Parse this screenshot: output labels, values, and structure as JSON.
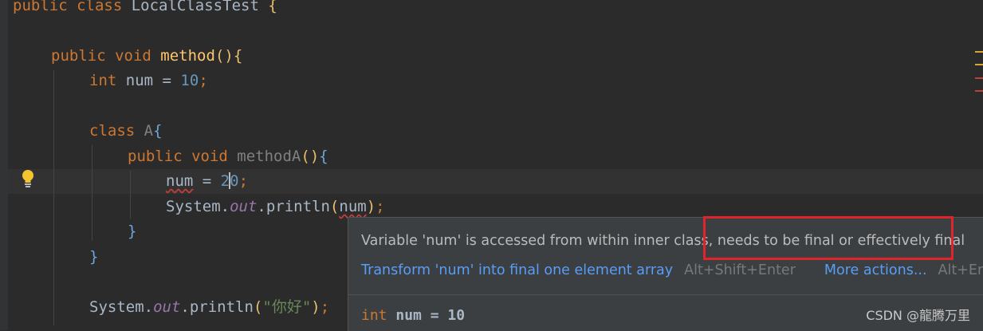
{
  "code": {
    "line1": {
      "kw": "public class",
      "name": "LocalClassTest",
      "brace": "{"
    },
    "line3": {
      "kw": "public void",
      "name": "method",
      "parens": "()",
      "brace": "{"
    },
    "line4": {
      "kw": "int",
      "rest": "num = ",
      "value": "10",
      "semi": ";"
    },
    "line6": {
      "kw": "class",
      "name": "A",
      "brace": "{"
    },
    "line7": {
      "kw": "public void",
      "name": "methodA",
      "parens": "()",
      "brace": "{"
    },
    "line8": {
      "var": "num",
      "op": " = ",
      "value_a": "2",
      "value_b": "0",
      "semi": ";"
    },
    "line9": {
      "cls": "System.",
      "field": "out",
      "call": ".println",
      "open": "(",
      "arg": "num",
      "close": ")",
      "semi": ";"
    },
    "line10": {
      "brace": "}"
    },
    "line11": {
      "brace": "}"
    },
    "line13": {
      "cls": "System.",
      "field": "out",
      "call": ".println",
      "open": "(",
      "str": "\"你好\"",
      "close": ")",
      "semi": ";"
    }
  },
  "popup": {
    "message_part1": "Variable 'num' is accessed from within inner class, ",
    "message_part2": "needs to be final or effectively final",
    "action1": "Transform 'num' into final one element array",
    "action1_shortcut": "Alt+Shift+Enter",
    "action2": "More actions...",
    "action2_shortcut": "Alt+Enter",
    "signature_type": "int ",
    "signature_name": "num",
    "signature_value": " = 10"
  },
  "watermark": "CSDN @龍腾万里",
  "colors": {
    "error": "#bc3f3c",
    "link": "#589df6",
    "highlight": "#e0242b"
  }
}
